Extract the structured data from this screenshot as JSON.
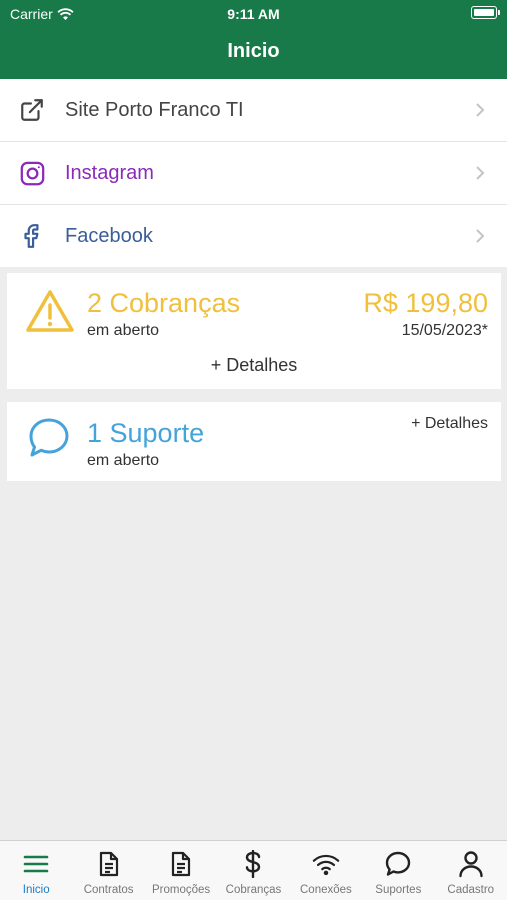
{
  "status_bar": {
    "carrier": "Carrier",
    "time": "9:11 AM"
  },
  "nav": {
    "title": "Inicio"
  },
  "links": [
    {
      "label": "Site Porto Franco TI",
      "icon": "external-link-icon",
      "color": "#444444"
    },
    {
      "label": "Instagram",
      "icon": "instagram-icon",
      "color": "#8a2bb8"
    },
    {
      "label": "Facebook",
      "icon": "facebook-icon",
      "color": "#3b5d9a"
    }
  ],
  "cobrancas": {
    "title": "2 Cobranças",
    "subtitle": "em aberto",
    "amount": "R$ 199,80",
    "date": "15/05/2023*",
    "details_label": "+ Detalhes",
    "color": "#f0c03c"
  },
  "suporte": {
    "title": "1 Suporte",
    "subtitle": "em aberto",
    "details_label": "+ Detalhes",
    "color": "#45a3dc"
  },
  "tabs": [
    {
      "label": "Inicio",
      "icon": "menu-icon",
      "active": true
    },
    {
      "label": "Contratos",
      "icon": "document-icon",
      "active": false
    },
    {
      "label": "Promoções",
      "icon": "document-icon",
      "active": false
    },
    {
      "label": "Cobranças",
      "icon": "dollar-icon",
      "active": false
    },
    {
      "label": "Conexões",
      "icon": "wifi-icon",
      "active": false
    },
    {
      "label": "Suportes",
      "icon": "chat-icon",
      "active": false
    },
    {
      "label": "Cadastro",
      "icon": "user-icon",
      "active": false
    }
  ],
  "colors": {
    "header": "#177a48",
    "active_tab": "#1a7cc4",
    "background": "#ededed"
  }
}
